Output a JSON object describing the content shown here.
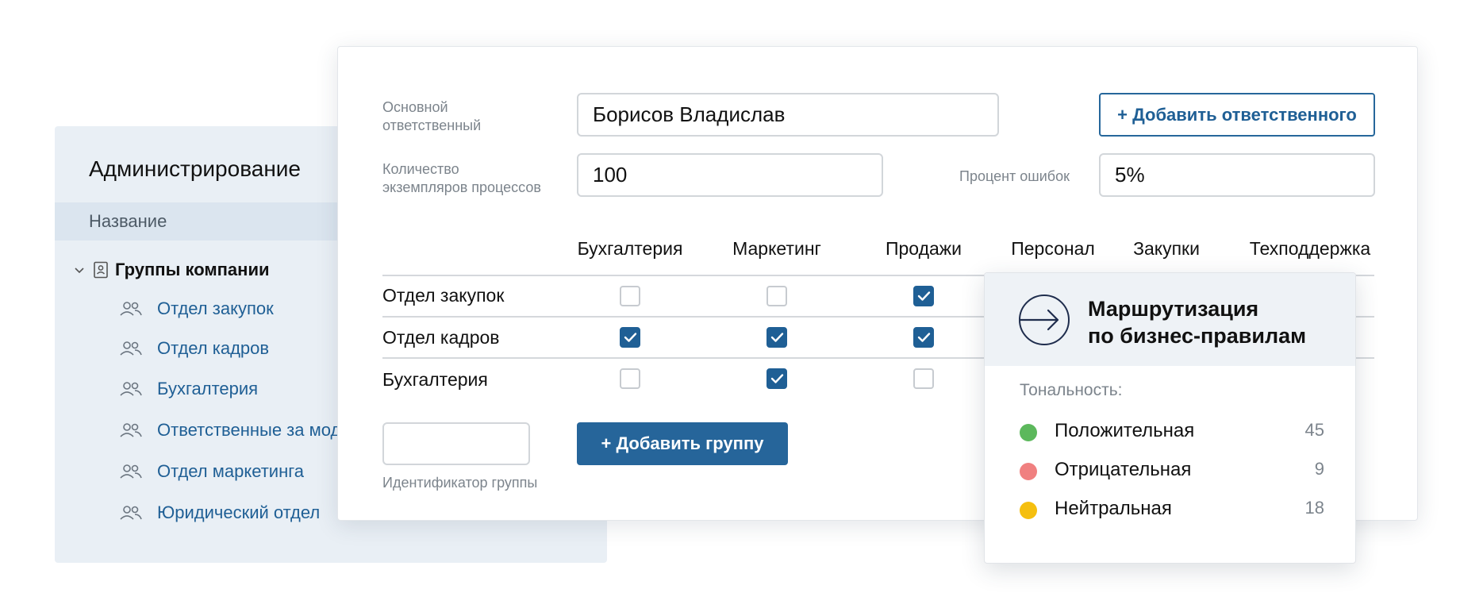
{
  "admin": {
    "title": "Администрирование",
    "column_header": "Название",
    "root_group": "Группы компании",
    "groups": [
      "Отдел закупок",
      "Отдел кадров",
      "Бухгалтерия",
      "Ответственные за мод",
      "Отдел маркетинга",
      "Юридический отдел"
    ]
  },
  "form": {
    "main_responsible_label_line1": "Основной",
    "main_responsible_label_line2": "ответственный",
    "main_responsible_value": "Борисов Владислав",
    "add_responsible_button": "+ Добавить ответственного",
    "process_count_label_line1": "Количество",
    "process_count_label_line2": "экземпляров процессов",
    "process_count_value": "100",
    "error_percent_label": "Процент ошибок",
    "error_percent_value": "5%",
    "columns": [
      "Бухгалтерия",
      "Маркетинг",
      "Продажи",
      "Персонал",
      "Закупки",
      "Техподдержка"
    ],
    "rows": [
      {
        "label": "Отдел закупок",
        "checks": [
          false,
          false,
          true
        ]
      },
      {
        "label": "Отдел кадров",
        "checks": [
          true,
          true,
          true
        ]
      },
      {
        "label": "Бухгалтерия",
        "checks": [
          false,
          true,
          false
        ]
      }
    ],
    "group_id_value": "",
    "group_id_label": "Идентификатор группы",
    "add_group_button": "+ Добавить группу"
  },
  "popup": {
    "title_line1": "Маршрутизация",
    "title_line2": "по бизнес-правилам",
    "tonality_label": "Тональность:",
    "items": [
      {
        "name": "Положительная",
        "count": "45",
        "color": "#5cb85c"
      },
      {
        "name": "Отрицательная",
        "count": "9",
        "color": "#f08080"
      },
      {
        "name": "Нейтральная",
        "count": "18",
        "color": "#f5bf0f"
      }
    ]
  },
  "colors": {
    "accent": "#26659a",
    "link": "#1f5f95",
    "panel_bg": "#e9eff5"
  }
}
